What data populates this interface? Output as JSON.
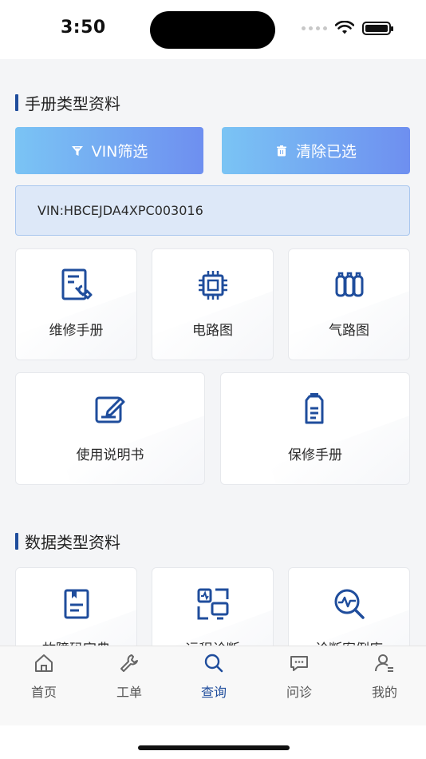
{
  "status_bar": {
    "time": "3:50"
  },
  "sections": {
    "manual_title": "手册类型资料",
    "data_title": "数据类型资料"
  },
  "actions": {
    "vin_filter": "VIN筛选",
    "clear_selected": "清除已选"
  },
  "vin": {
    "text": "VIN:HBCEJDA4XPC003016"
  },
  "manual_cards": [
    {
      "label": "维修手册",
      "icon": "repair-manual-icon"
    },
    {
      "label": "电路图",
      "icon": "circuit-chip-icon"
    },
    {
      "label": "气路图",
      "icon": "gas-cylinders-icon"
    },
    {
      "label": "使用说明书",
      "icon": "edit-document-icon"
    },
    {
      "label": "保修手册",
      "icon": "warranty-bottle-icon"
    }
  ],
  "data_cards": [
    {
      "label": "故障码字典",
      "icon": "dtc-book-icon"
    },
    {
      "label": "远程诊断",
      "icon": "remote-screen-icon"
    },
    {
      "label": "诊断案例库",
      "icon": "diagnosis-search-icon"
    }
  ],
  "tabs": [
    {
      "label": "首页",
      "icon": "home-icon"
    },
    {
      "label": "工单",
      "icon": "wrench-icon"
    },
    {
      "label": "查询",
      "icon": "search-icon",
      "active": true
    },
    {
      "label": "问诊",
      "icon": "chat-icon"
    },
    {
      "label": "我的",
      "icon": "user-icon"
    }
  ],
  "colors": {
    "accent": "#1f4d9c",
    "gradient_start": "#7ac4f4",
    "gradient_end": "#6e8ff0"
  }
}
